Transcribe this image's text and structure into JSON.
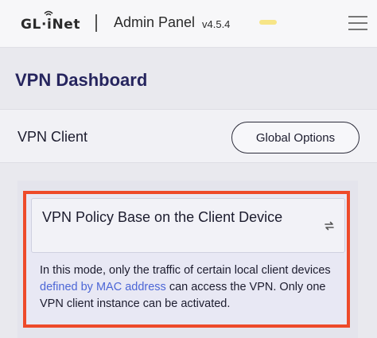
{
  "header": {
    "logo_text": "GL·iNet",
    "admin_title": "Admin Panel",
    "version": "v4.5.4",
    "menu_icon": "hamburger-menu-icon"
  },
  "page": {
    "title": "VPN Dashboard"
  },
  "section": {
    "title": "VPN Client",
    "global_options_label": "Global Options"
  },
  "mode": {
    "label": "VPN Policy Base on the Client Device",
    "swap_icon": "swap-arrows-icon",
    "description_part1": "In this mode, only the traffic of certain local client devices",
    "description_link": "defined by MAC address",
    "description_part2": "can access the VPN. Only one VPN client instance can be activated."
  },
  "colors": {
    "title": "#26255e",
    "highlight_border": "#ee4a2a",
    "link": "#4c66d6"
  }
}
